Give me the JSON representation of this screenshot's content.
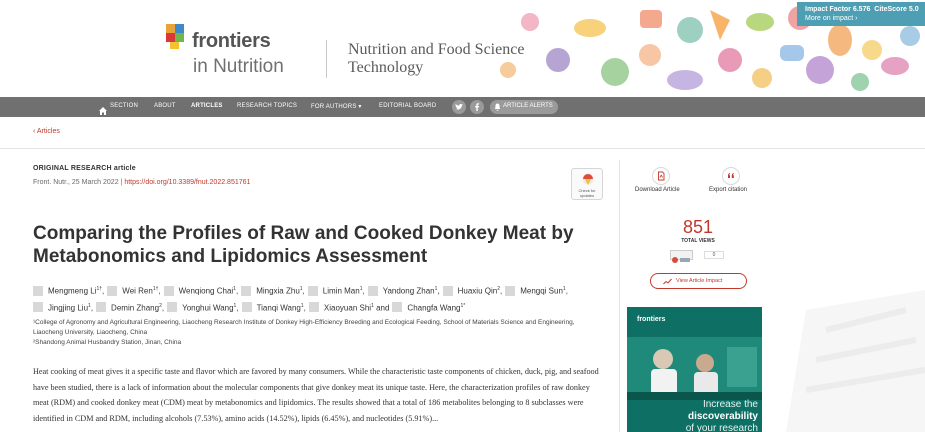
{
  "colors": {
    "accent": "#c0392b",
    "nav_bg": "#707070",
    "impact_bg": "#4f9fb4",
    "ad_bg": "#0e6f64"
  },
  "header": {
    "logo_word": "frontiers",
    "logo_sub": "in Nutrition",
    "journal_line1": "Nutrition and Food Science",
    "journal_line2": "Technology",
    "impact_factor": "Impact Factor 6.576",
    "citescore": "CiteScore 5.0",
    "more_on_impact": "More on impact ›"
  },
  "nav": {
    "items": [
      {
        "label": "SECTION",
        "icon": "home-icon"
      },
      {
        "label": "ABOUT"
      },
      {
        "label": "ARTICLES",
        "active": true
      },
      {
        "label": "RESEARCH TOPICS"
      },
      {
        "label": "FOR AUTHORS ▾"
      },
      {
        "label": "EDITORIAL BOARD"
      }
    ],
    "social": [
      "twitter-icon",
      "facebook-icon"
    ],
    "alerts_label": "ARTICLE ALERTS"
  },
  "breadcrumb": {
    "label": "‹ Articles"
  },
  "article": {
    "type": "ORIGINAL RESEARCH article",
    "citation_prefix": "Front. Nutr., 25 March 2022 |",
    "doi": "https://doi.org/10.3389/fnut.2022.851761",
    "check_updates": "Check for updates",
    "title": "Comparing the Profiles of Raw and Cooked Donkey Meat by Metabonomics and Lipidomics Assessment",
    "authors": [
      {
        "name": "Mengmeng Li",
        "sup": "1†",
        "sep": ","
      },
      {
        "name": "Wei Ren",
        "sup": "1†",
        "sep": ","
      },
      {
        "name": "Wenqiong Chai",
        "sup": "1",
        "sep": ","
      },
      {
        "name": "Mingxia Zhu",
        "sup": "1",
        "sep": ","
      },
      {
        "name": "Limin Man",
        "sup": "1",
        "sep": ","
      },
      {
        "name": "Yandong Zhan",
        "sup": "1",
        "sep": ","
      },
      {
        "name": "Huaxiu Qin",
        "sup": "2",
        "sep": ","
      },
      {
        "name": "Mengqi Sun",
        "sup": "1",
        "sep": ","
      },
      {
        "name": "Jingjing Liu",
        "sup": "1",
        "sep": ","
      },
      {
        "name": "Demin Zhang",
        "sup": "2",
        "sep": ","
      },
      {
        "name": "Yonghui Wang",
        "sup": "1",
        "sep": ","
      },
      {
        "name": "Tianqi Wang",
        "sup": "1",
        "sep": ","
      },
      {
        "name": "Xiaoyuan Shi",
        "sup": "1",
        "sep": " and"
      },
      {
        "name": "Changfa Wang",
        "sup": "1*",
        "sep": ""
      }
    ],
    "affiliation_1": "¹College of Agronomy and Agricultural Engineering, Liaocheng Research Institute of Donkey High-Efficiency Breeding and Ecological Feeding, School of Materials Science and Engineering, Liaocheng University, Liaocheng, China",
    "affiliation_2": "²Shandong Animal Husbandry Station, Jinan, China",
    "abstract": "Heat cooking of meat gives it a specific taste and flavor which are favored by many consumers. While the characteristic taste components of chicken, duck, pig, and seafood have been studied, there is a lack of information about the molecular components that give donkey meat its unique taste. Here, the characterization profiles of raw donkey meat (RDM) and cooked donkey meat (CDM) meat by metabonomics and lipidomics. The results showed that a total of 186 metabolites belonging to 8 subclasses were identified in CDM and RDM, including alcohols (7.53%), amino acids (14.52%), lipids (6.45%), and nucleotides (5.91%)..."
  },
  "sidebar": {
    "download_label": "Download Article",
    "export_label": "Export citation",
    "views_count": "851",
    "views_label": "TOTAL VIEWS",
    "altmetric_count": "0",
    "impact_button": "View Article Impact",
    "ad_brand": "frontiers",
    "ad_line1": "Increase the",
    "ad_line2": "discoverability",
    "ad_line3": "of your research"
  }
}
